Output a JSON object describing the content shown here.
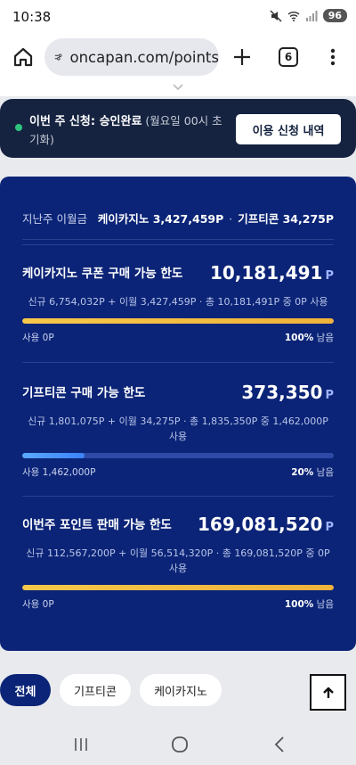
{
  "status_bar": {
    "time": "10:38",
    "battery": "96",
    "icons": [
      "mute-icon",
      "wifi-icon",
      "signal-icon"
    ]
  },
  "browser": {
    "url": "oncapan.com/points",
    "tab_count": "6",
    "icons": [
      "home-icon",
      "site-settings-icon",
      "plus-icon",
      "more-icon"
    ]
  },
  "notice": {
    "prefix": "이번 주 신청: ",
    "status": "승인완료",
    "note": " (월요일 00시 초기화)",
    "button_label": "이용 신청 내역",
    "dot_color": "#2ec27e"
  },
  "summary": {
    "label": "지난주 이월금",
    "casino": "케이카지노 3,427,459P",
    "separator": "·",
    "gifticon": "기프티콘 34,275P"
  },
  "sections": [
    {
      "title": "케이카지노 쿠폰 구매 가능 한도",
      "amount": "10,181,491",
      "unit": "P",
      "detail": "신규 6,754,032P + 이월 3,427,459P · 총 10,181,491P 중 0P 사용",
      "used": "사용 0P",
      "remaining_pct": "100%",
      "remaining_label": " 남음",
      "fill_fraction": 1.0,
      "bar_color": "gold"
    },
    {
      "title": "기프티콘 구매 가능 한도",
      "amount": "373,350",
      "unit": "P",
      "detail": "신규 1,801,075P + 이월 34,275P · 총 1,835,350P 중 1,462,000P 사용",
      "used": "사용 1,462,000P",
      "remaining_pct": "20%",
      "remaining_label": " 남음",
      "fill_fraction": 0.2,
      "bar_color": "blue"
    },
    {
      "title": "이번주 포인트 판매 가능 한도",
      "amount": "169,081,520",
      "unit": "P",
      "detail": "신규 112,567,200P + 이월 56,514,320P · 총 169,081,520P 중 0P 사용",
      "used": "사용 0P",
      "remaining_pct": "100%",
      "remaining_label": " 남음",
      "fill_fraction": 1.0,
      "bar_color": "gold"
    }
  ],
  "filters": {
    "items": [
      "전체",
      "기프티콘",
      "케이카지노"
    ],
    "active": "전체"
  },
  "scroll_top": {
    "icon": "arrow-up-icon"
  },
  "nav": {
    "icons": [
      "recents-icon",
      "home-circle-icon",
      "back-icon"
    ]
  },
  "colors": {
    "card_bg": "#0b2477",
    "notice_bg": "#152340",
    "gold_bar": "#f7c84a",
    "blue_bar": "#3b82f6"
  }
}
